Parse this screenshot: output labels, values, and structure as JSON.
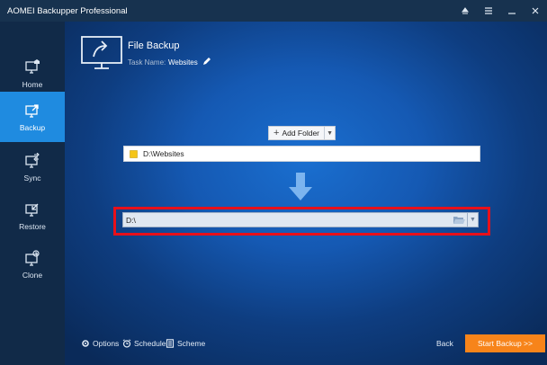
{
  "window": {
    "title": "AOMEI Backupper Professional",
    "controls": [
      "menu-icon",
      "list-icon",
      "minimize-icon",
      "close-icon"
    ]
  },
  "sidebar": {
    "items": [
      {
        "label": "Home",
        "icon": "home-monitor-icon",
        "active": false
      },
      {
        "label": "Backup",
        "icon": "backup-icon",
        "active": true
      },
      {
        "label": "Sync",
        "icon": "sync-icon",
        "active": false
      },
      {
        "label": "Restore",
        "icon": "restore-icon",
        "active": false
      },
      {
        "label": "Clone",
        "icon": "clone-icon",
        "active": false
      }
    ]
  },
  "header": {
    "title": "File Backup",
    "task_label": "Task Name:",
    "task_name": "Websites"
  },
  "source": {
    "add_folder_label": "Add Folder",
    "path": "D:\\Websites"
  },
  "destination": {
    "path": "D:\\"
  },
  "bottom": {
    "options_label": "Options",
    "schedule_label": "Schedule",
    "scheme_label": "Scheme",
    "back_label": "Back",
    "start_label": "Start Backup >>"
  },
  "colors": {
    "accent": "#1f8be0",
    "start_button": "#f7841a",
    "highlight_frame": "#e8101a"
  }
}
